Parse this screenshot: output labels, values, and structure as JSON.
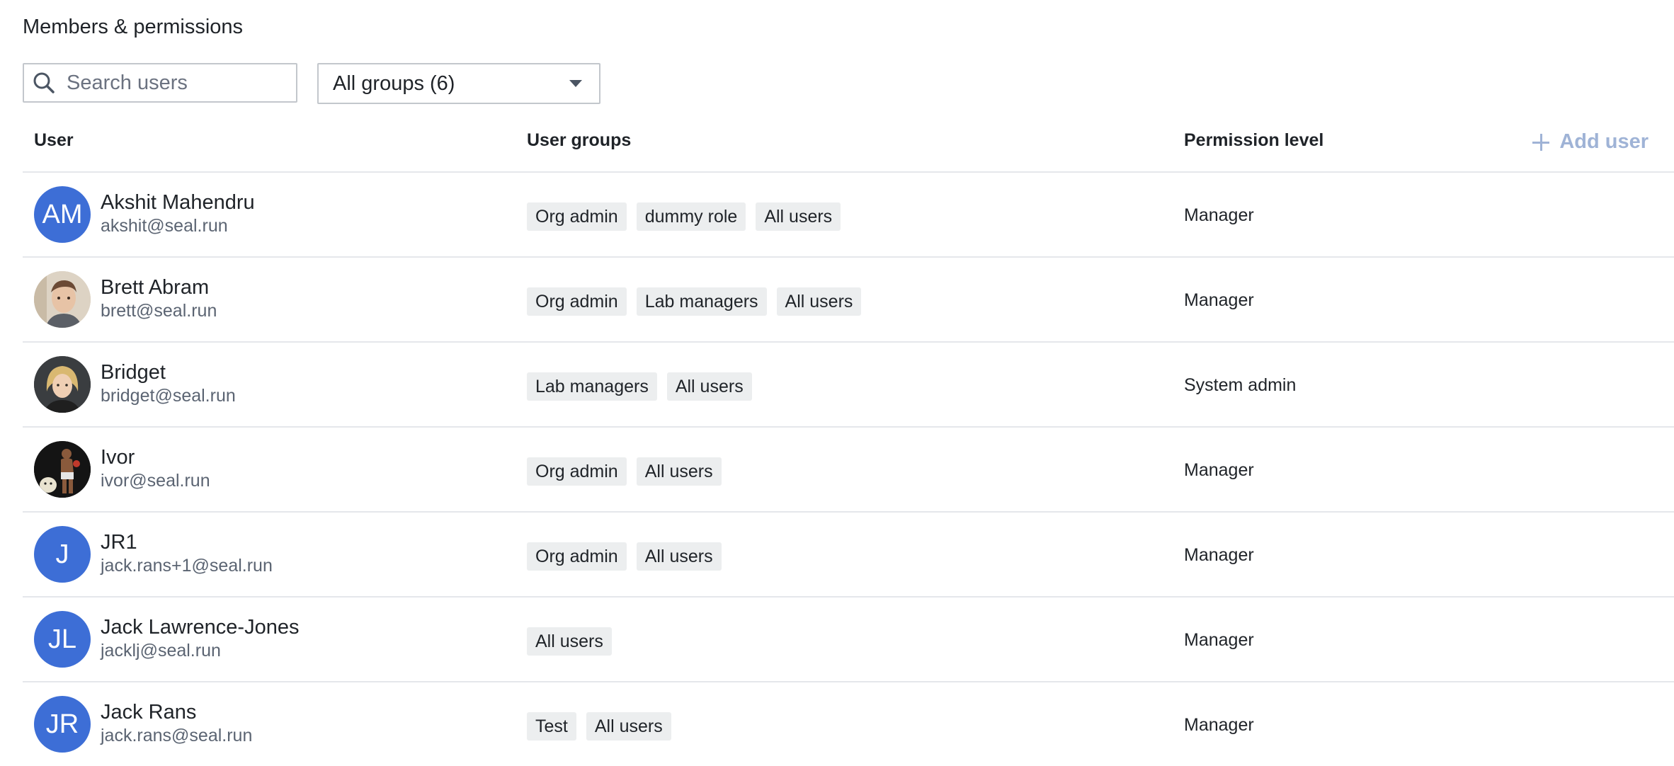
{
  "page_title": "Members & permissions",
  "search": {
    "placeholder": "Search users",
    "value": ""
  },
  "groups_filter": {
    "selected": "All groups (6)"
  },
  "table": {
    "headers": {
      "user": "User",
      "groups": "User groups",
      "permission": "Permission level"
    },
    "add_user_label": "Add user",
    "rows": [
      {
        "name": "Akshit Mahendru",
        "email": "akshit@seal.run",
        "initials": "AM",
        "avatar_type": "initials",
        "groups": [
          "Org admin",
          "dummy role",
          "All users"
        ],
        "permission": "Manager"
      },
      {
        "name": "Brett Abram",
        "email": "brett@seal.run",
        "initials": "",
        "avatar_type": "photo",
        "groups": [
          "Org admin",
          "Lab managers",
          "All users"
        ],
        "permission": "Manager"
      },
      {
        "name": "Bridget",
        "email": "bridget@seal.run",
        "initials": "",
        "avatar_type": "photo",
        "groups": [
          "Lab managers",
          "All users"
        ],
        "permission": "System admin"
      },
      {
        "name": "Ivor",
        "email": "ivor@seal.run",
        "initials": "",
        "avatar_type": "photo",
        "groups": [
          "Org admin",
          "All users"
        ],
        "permission": "Manager"
      },
      {
        "name": "JR1",
        "email": "jack.rans+1@seal.run",
        "initials": "J",
        "avatar_type": "initials",
        "groups": [
          "Org admin",
          "All users"
        ],
        "permission": "Manager"
      },
      {
        "name": "Jack Lawrence-Jones",
        "email": "jacklj@seal.run",
        "initials": "JL",
        "avatar_type": "initials",
        "groups": [
          "All users"
        ],
        "permission": "Manager"
      },
      {
        "name": "Jack Rans",
        "email": "jack.rans@seal.run",
        "initials": "JR",
        "avatar_type": "initials",
        "groups": [
          "Test",
          "All users"
        ],
        "permission": "Manager"
      }
    ]
  },
  "colors": {
    "avatar_bg": "#3d6ed6",
    "tag_bg": "#eceeef",
    "add_user": "#9fb3d6",
    "divider": "#e5e7eb"
  },
  "icons": {
    "search": "search-icon",
    "dropdown": "caret-down-icon",
    "add": "plus-icon"
  }
}
